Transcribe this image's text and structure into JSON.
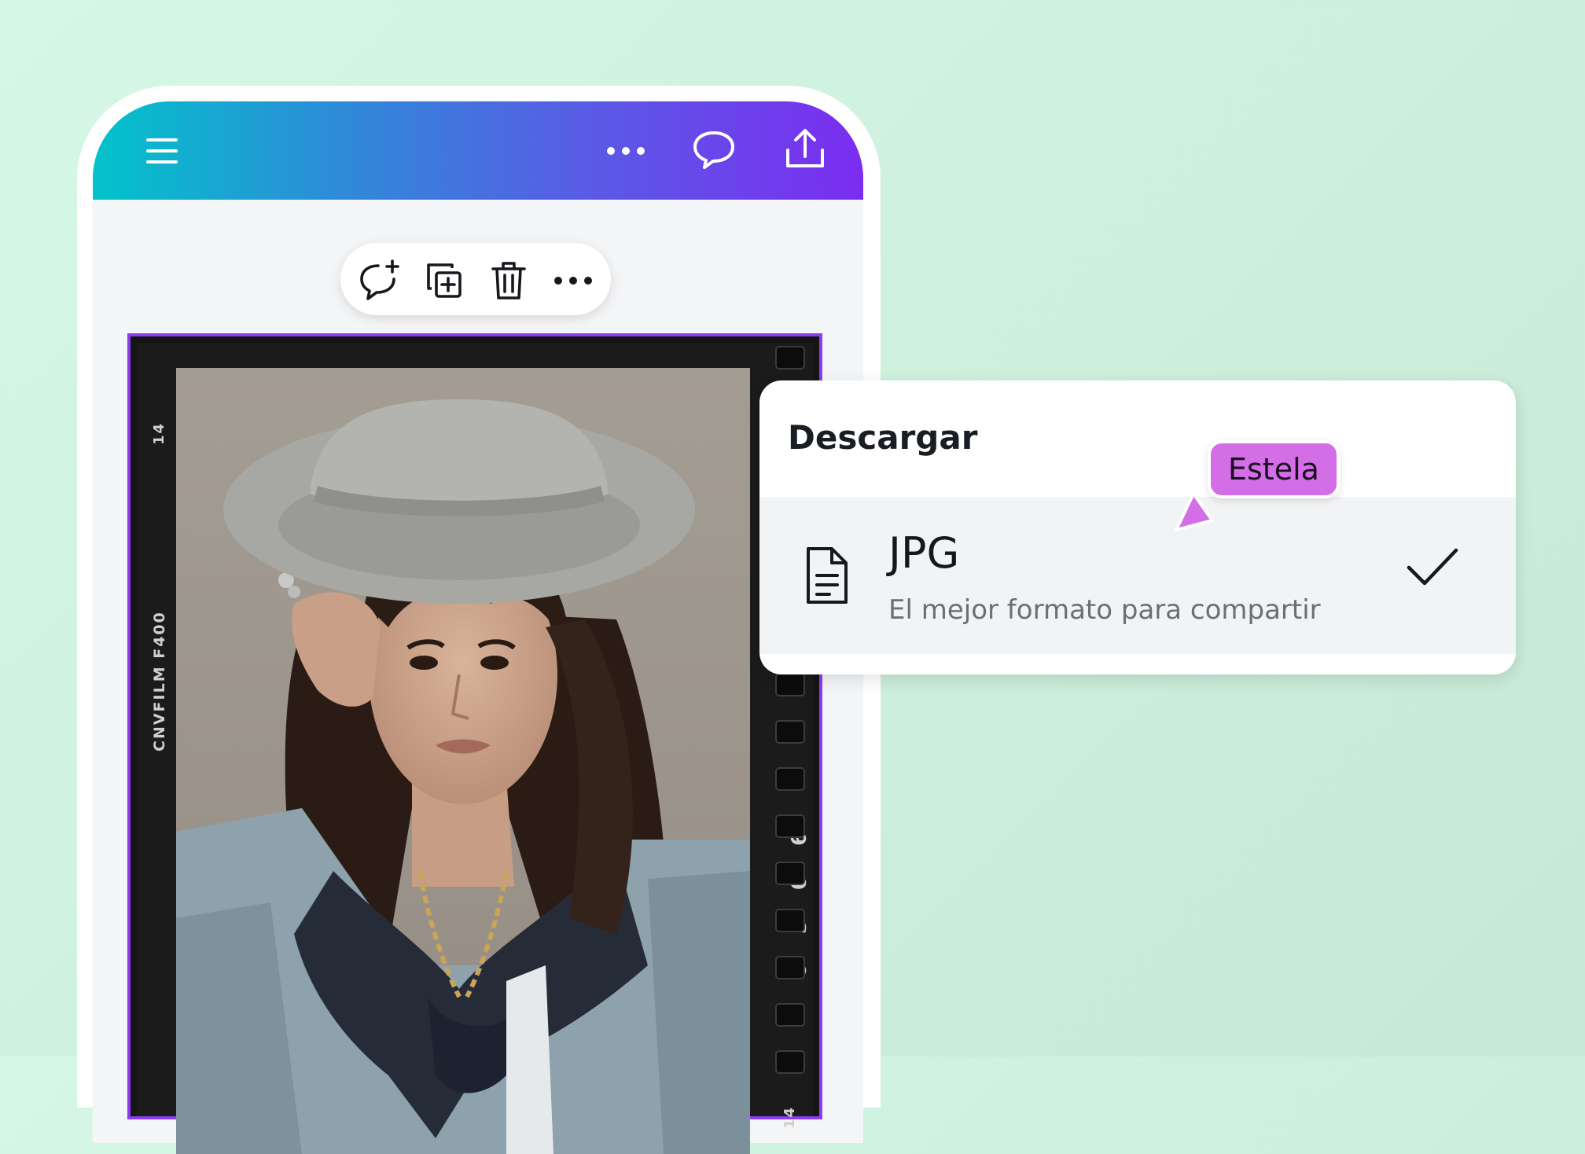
{
  "download_panel": {
    "title": "Descargar",
    "option": {
      "name": "JPG",
      "description": "El mejor formato para compartir",
      "selected": true,
      "icon": "file-document-icon"
    }
  },
  "collaborator": {
    "name": "Estela",
    "color": "#d36ee6"
  },
  "film_frame": {
    "side_label": "CNVFILM F400",
    "top_number": "14",
    "bottom_number": "14",
    "right_digits": [
      "6",
      "0",
      "3",
      "6"
    ]
  },
  "icons": {
    "menu": "hamburger-menu-icon",
    "more": "more-horizontal-icon",
    "comment": "comment-icon",
    "share": "share-upload-icon",
    "add_comment": "add-comment-icon",
    "duplicate": "duplicate-icon",
    "delete": "trash-icon",
    "toolbar_more": "more-horizontal-icon"
  },
  "colors": {
    "header_gradient_start": "#02c3cb",
    "header_gradient_end": "#7b2df0",
    "selection_border": "#8b3cf0"
  }
}
